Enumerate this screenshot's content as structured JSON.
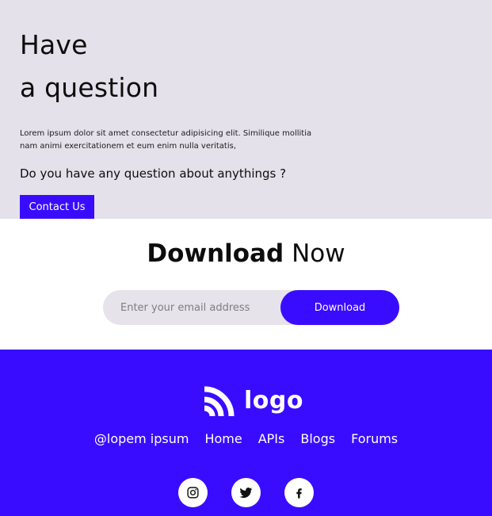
{
  "hero": {
    "title_line1": "Have",
    "title_line2": "a question",
    "description": "Lorem ipsum dolor sit amet consectetur adipisicing elit. Similique mollitia nam animi exercitationem et eum enim nulla veritatis,",
    "question": "Do you have any question about anythings ?",
    "contact_label": "Contact Us"
  },
  "download": {
    "title_bold": "Download",
    "title_light": "Now",
    "email_placeholder": "Enter your email address",
    "email_value": "",
    "button_label": "Download"
  },
  "footer": {
    "logo_text": "logo",
    "links": [
      {
        "label": "@lopem ipsum"
      },
      {
        "label": "Home"
      },
      {
        "label": "APIs"
      },
      {
        "label": "Blogs"
      },
      {
        "label": "Forums"
      }
    ],
    "socials": [
      {
        "icon": "instagram-icon"
      },
      {
        "icon": "twitter-icon"
      },
      {
        "icon": "facebook-icon"
      }
    ]
  },
  "colors": {
    "accent": "#3a0cff",
    "hero_background": "#e4e1ea",
    "input_background": "#e6e3ea",
    "text": "#0d0d0d",
    "footer_text": "#ffffff"
  }
}
